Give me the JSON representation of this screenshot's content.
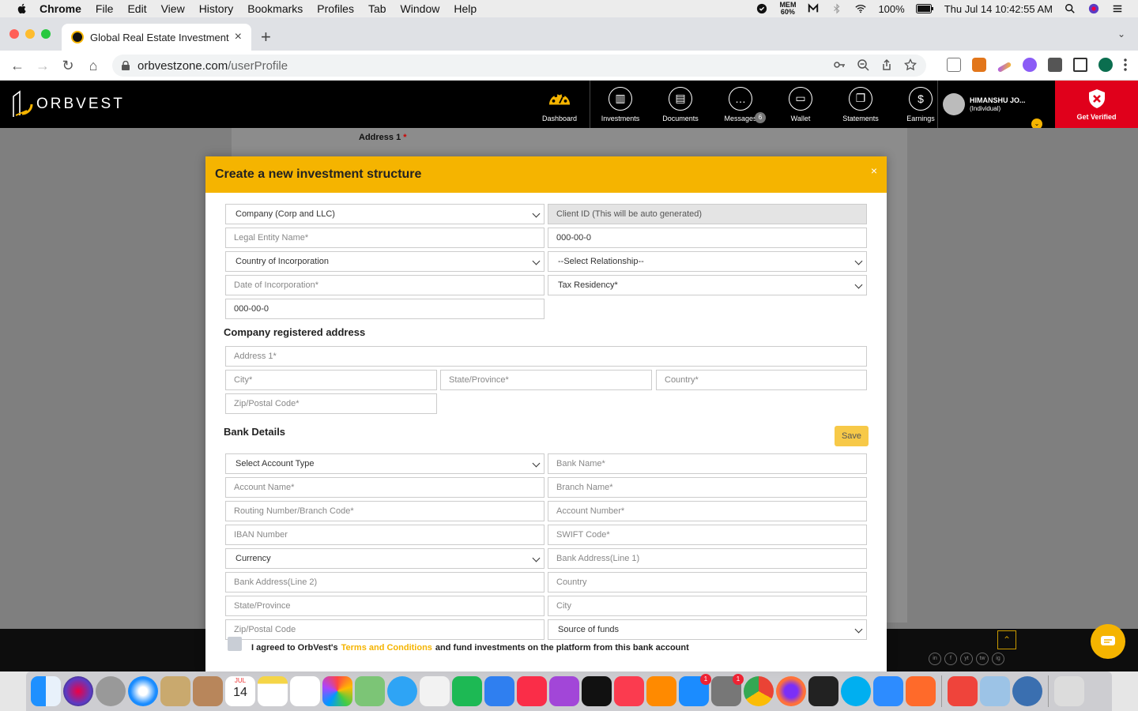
{
  "menubar": {
    "app": "Chrome",
    "items": [
      "File",
      "Edit",
      "View",
      "History",
      "Bookmarks",
      "Profiles",
      "Tab",
      "Window",
      "Help"
    ],
    "mem_label": "MEM",
    "mem_value": "60%",
    "battery": "100%",
    "datetime": "Thu Jul 14  10:42:55 AM"
  },
  "browser": {
    "tab_title": "Global Real Estate Investment",
    "url_host": "orbvestzone.com",
    "url_path": "/userProfile"
  },
  "site": {
    "logo_text": "ORBVEST",
    "nav": [
      {
        "label": "Dashboard",
        "icon": "dashboard-icon"
      },
      {
        "label": "Investments",
        "icon": "building-icon"
      },
      {
        "label": "Documents",
        "icon": "document-icon"
      },
      {
        "label": "Messages",
        "icon": "chat-icon",
        "badge": "6"
      },
      {
        "label": "Wallet",
        "icon": "wallet-icon"
      },
      {
        "label": "Statements",
        "icon": "statements-icon"
      },
      {
        "label": "Earnings",
        "icon": "dollar-icon"
      }
    ],
    "user_name": "HIMANSHU JO...",
    "user_type": "(Individual)",
    "verify_label": "Get Verified",
    "bg_address_label": "Address 1",
    "accent": "#f5b400",
    "verify_color": "#e0001b"
  },
  "modal": {
    "title": "Create a new investment structure",
    "close": "×",
    "entity_type": "Company (Corp and LLC)",
    "client_id_placeholder": "Client ID (This will be auto generated)",
    "legal_entity_placeholder": "Legal Entity Name*",
    "phone_value_1": "000-00-0",
    "country_of_incorporation": "Country of Incorporation",
    "relationship": "--Select Relationship--",
    "date_of_incorporation_placeholder": "Date of Incorporation*",
    "tax_residency": "Tax Residency*",
    "phone_value_2": "000-00-0",
    "company_address_title": "Company registered address",
    "address1_placeholder": "Address 1*",
    "city_placeholder": "City*",
    "state_placeholder": "State/Province*",
    "country_placeholder": "Country*",
    "zip_placeholder": "Zip/Postal Code*",
    "bank_title": "Bank Details",
    "save_label": "Save",
    "account_type": "Select Account Type",
    "bank_name_placeholder": "Bank Name*",
    "account_name_placeholder": "Account Name*",
    "branch_name_placeholder": "Branch Name*",
    "routing_placeholder": "Routing Number/Branch Code*",
    "account_number_placeholder": "Account Number*",
    "iban_placeholder": "IBAN Number",
    "swift_placeholder": "SWIFT Code*",
    "currency": "Currency",
    "bank_address1_placeholder": "Bank Address(Line 1)",
    "bank_address2_placeholder": "Bank Address(Line 2)",
    "bank_country_placeholder": "Country",
    "bank_state_placeholder": "State/Province",
    "bank_city_placeholder": "City",
    "bank_zip_placeholder": "Zip/Postal Code",
    "source_of_funds": "Source of funds",
    "agree_prefix": "I agreed to OrbVest's",
    "agree_link": "Terms and Conditions",
    "agree_suffix": "and fund investments on the platform from this bank account"
  },
  "footer": {
    "social": [
      "in",
      "f",
      "yt",
      "tw",
      "ig"
    ]
  },
  "dock": {
    "calendar_month": "JUL",
    "calendar_day": "14",
    "appstore_badge": "1",
    "settings_badge": "1"
  }
}
